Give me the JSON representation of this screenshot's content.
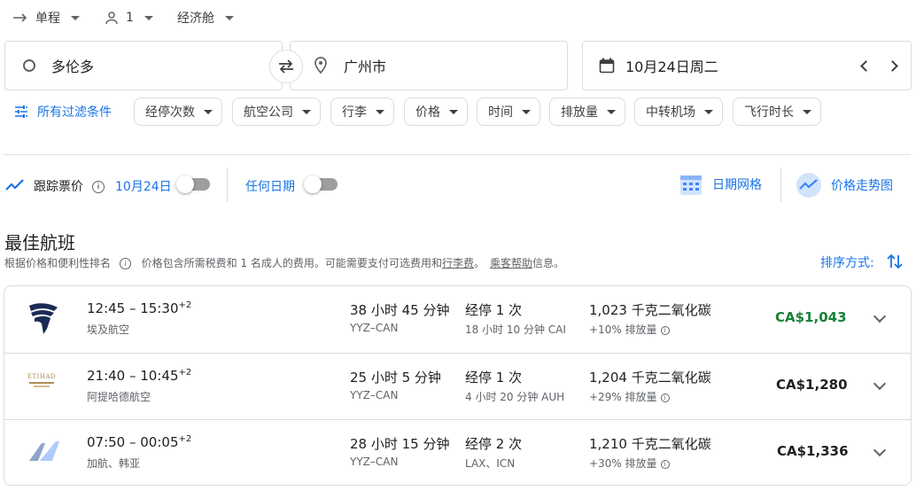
{
  "trip": {
    "type_label": "单程",
    "passengers_label": "1",
    "cabin_label": "经济舱"
  },
  "search": {
    "origin": "多伦多",
    "destination": "广州市",
    "date": "10月24日周二"
  },
  "filters": {
    "all_label": "所有过滤条件",
    "chips": [
      "经停次数",
      "航空公司",
      "行李",
      "价格",
      "时间",
      "排放量",
      "中转机场",
      "飞行时长"
    ]
  },
  "tracking": {
    "track_label": "跟踪票价",
    "date_label": "10月24日",
    "any_date_label": "任何日期",
    "date_grid_label": "日期网格",
    "price_graph_label": "价格走势图"
  },
  "results": {
    "heading": "最佳航班",
    "subtitle_prefix": "根据价格和便利性排名",
    "subtitle_main": "价格包含所需税费和 1 名成人的费用。可能需要支付可选费用和",
    "subtitle_link1": "行李费",
    "subtitle_mid": "。",
    "subtitle_link2": "乘客帮助",
    "subtitle_end": "信息。",
    "sort_label": "排序方式:"
  },
  "flights": [
    {
      "times": "12:45 – 15:30",
      "day_offset": "+2",
      "airline": "埃及航空",
      "duration": "38 小时 45 分钟",
      "route": "YYZ–CAN",
      "stops": "经停 1 次",
      "stop_detail": "18 小时 10 分钟 CAI",
      "emissions": "1,023 千克二氧化碳",
      "emissions_delta": "+10% 排放量",
      "price": "CA$1,043",
      "price_color": "#188038"
    },
    {
      "times": "21:40 – 10:45",
      "day_offset": "+2",
      "airline": "阿提哈德航空",
      "duration": "25 小时 5 分钟",
      "route": "YYZ–CAN",
      "stops": "经停 1 次",
      "stop_detail": "4 小时 20 分钟 AUH",
      "emissions": "1,204 千克二氧化碳",
      "emissions_delta": "+29% 排放量",
      "price": "CA$1,280",
      "price_color": "#202124",
      "logo_text": "ETIHAD"
    },
    {
      "times": "07:50 – 00:05",
      "day_offset": "+2",
      "airline": "加航、韩亚",
      "duration": "28 小时 15 分钟",
      "route": "YYZ–CAN",
      "stops": "经停 2 次",
      "stop_detail": "LAX、ICN",
      "emissions": "1,210 千克二氧化碳",
      "emissions_delta": "+30% 排放量",
      "price": "CA$1,336",
      "price_color": "#202124"
    }
  ]
}
